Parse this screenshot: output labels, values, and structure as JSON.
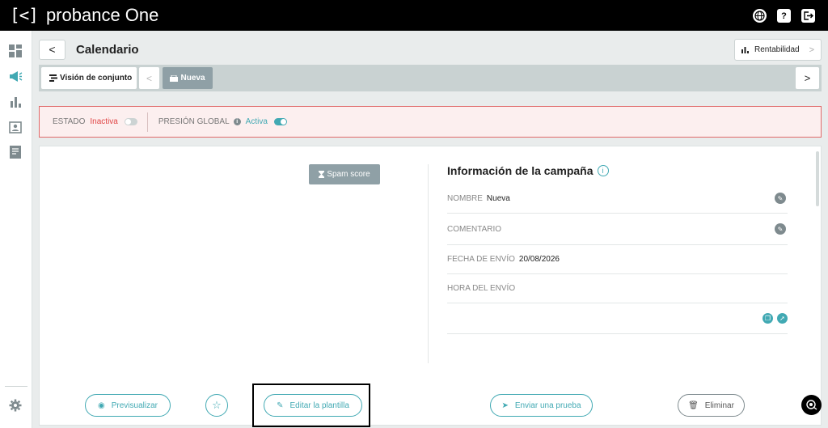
{
  "brand": {
    "mark": "[<]",
    "name": "probance One"
  },
  "topbar": {
    "icons": [
      "globe-icon",
      "help-icon",
      "logout-icon"
    ],
    "help_glyph": "?"
  },
  "sidebar": {
    "icons": [
      "dashboard-icon",
      "campaigns-megaphone-icon",
      "stats-bar-icon",
      "contacts-icon",
      "reports-icon",
      "settings-gear-icon"
    ]
  },
  "header": {
    "back": "<",
    "title": "Calendario",
    "rentabilidad": "Rentabilidad",
    "chevron": ">"
  },
  "tabs": {
    "overview": "Visión de conjunto",
    "prev": "<",
    "current": "Nueva",
    "next": ">"
  },
  "status": {
    "estado_label": "ESTADO",
    "estado_value": "Inactiva",
    "presion_label": "PRESIÓN GLOBAL",
    "presion_value": "Activa",
    "info_glyph": "i"
  },
  "main": {
    "spam_score": "Spam score",
    "info_title": "Información de la campaña",
    "info_glyph": "i",
    "fields": [
      {
        "label": "NOMBRE",
        "value": "Nueva"
      },
      {
        "label": "COMENTARIO",
        "value": ""
      },
      {
        "label": "FECHA DE ENVÍO",
        "value": "20/08/2026"
      },
      {
        "label": "HORA DEL ENVÍO",
        "value": ""
      }
    ]
  },
  "actions": {
    "preview": "Previsualizar",
    "edit_template": "Editar la plantilla",
    "send_test": "Enviar una prueba",
    "delete": "Eliminar"
  },
  "colors": {
    "accent": "#41a9b3",
    "danger": "#e04646",
    "tab_active": "#8fa0a6",
    "topbar": "#000000"
  }
}
